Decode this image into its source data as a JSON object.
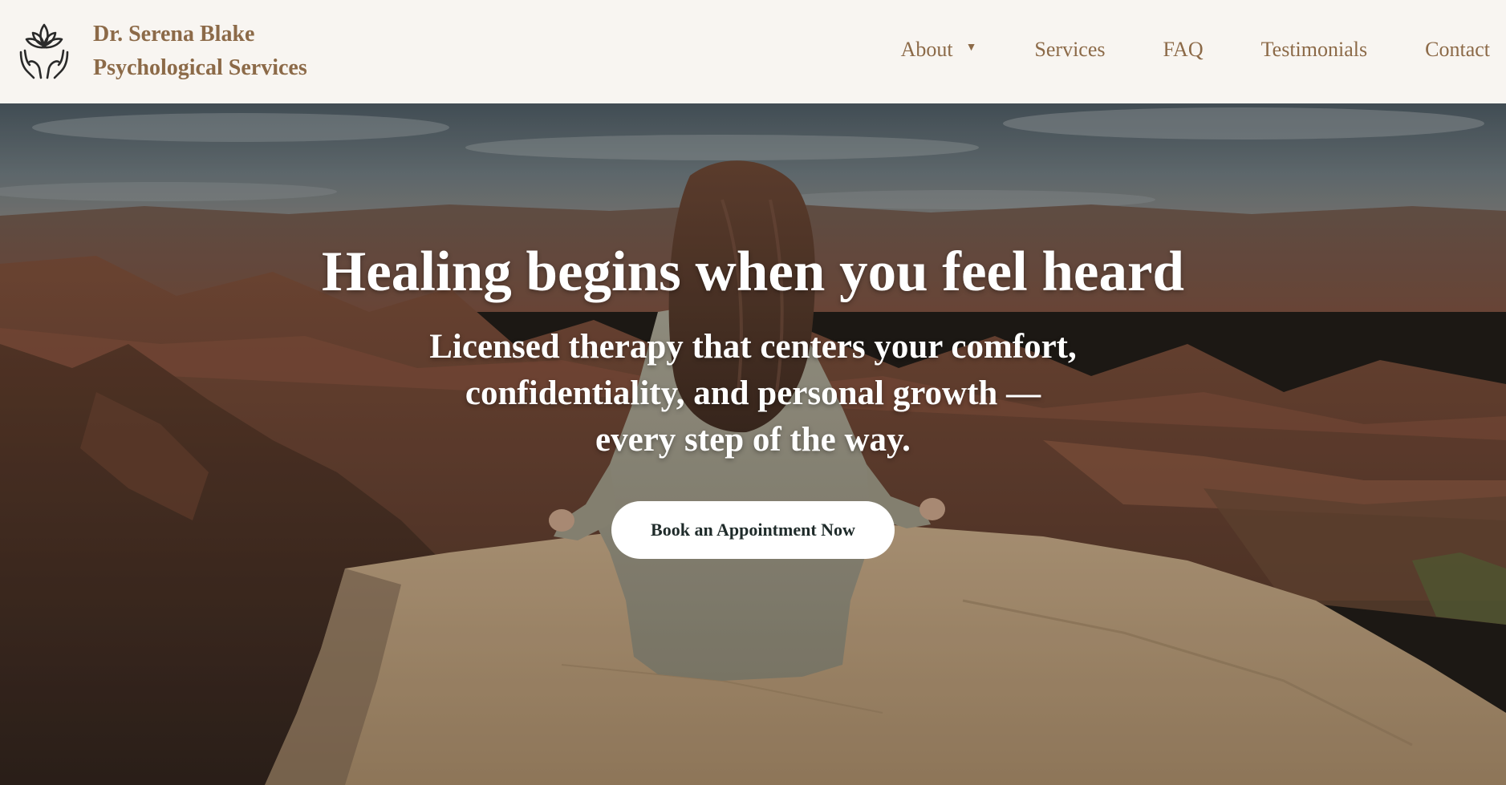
{
  "brand": {
    "line1": "Dr. Serena Blake",
    "line2": "Psychological Services",
    "logo_icon": "lotus-hands-icon",
    "color": "#8c6a48"
  },
  "nav": {
    "items": [
      {
        "label": "About",
        "has_dropdown": true,
        "dropdown_icon": "caret-down-icon"
      },
      {
        "label": "Services"
      },
      {
        "label": "FAQ"
      },
      {
        "label": "Testimonials"
      },
      {
        "label": "Contact"
      }
    ],
    "caret": "▼"
  },
  "hero": {
    "title": "Healing begins when you feel heard",
    "subtitle_lines": [
      "Licensed therapy that centers your comfort,",
      "confidentiality, and personal growth —",
      "every step of  the way."
    ],
    "cta_label": "Book an Appointment Now",
    "background": "woman meditating on canyon cliff edge"
  },
  "colors": {
    "header_bg": "#f8f5f1",
    "accent": "#8c6a48",
    "cta_bg": "#ffffff",
    "cta_text": "#1f2b2a"
  }
}
